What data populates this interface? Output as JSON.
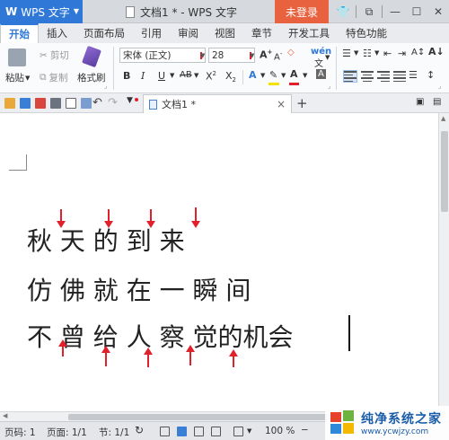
{
  "titlebar": {
    "app_name": "WPS 文字",
    "doc_title": "文档1 * - WPS 文字",
    "login_label": "未登录"
  },
  "menu": {
    "tabs": [
      "开始",
      "插入",
      "页面布局",
      "引用",
      "审阅",
      "视图",
      "章节",
      "开发工具",
      "特色功能"
    ]
  },
  "ribbon": {
    "paste_label": "粘贴",
    "cut_label": "剪切",
    "copy_label": "复制",
    "format_painter_label": "格式刷",
    "font_name": "宋体 (正文)",
    "font_size": "28",
    "wen_label": "文"
  },
  "doc_tab": {
    "label": "文档1 *"
  },
  "document": {
    "lines": [
      "秋 天 的 到 来",
      "仿 佛 就 在 一 瞬 间",
      "不 曾 给 人 察 觉的机会"
    ]
  },
  "statusbar": {
    "page_num": "页码: 1",
    "pages": "页面: 1/1",
    "section": "节: 1/1",
    "zoom": "100 %"
  },
  "watermark": {
    "title": "纯净系统之家",
    "url": "www.ycwjzy.com"
  },
  "colors": {
    "accent": "#2f78d8",
    "login": "#e8623f",
    "annotation_arrow": "#e0202a"
  }
}
